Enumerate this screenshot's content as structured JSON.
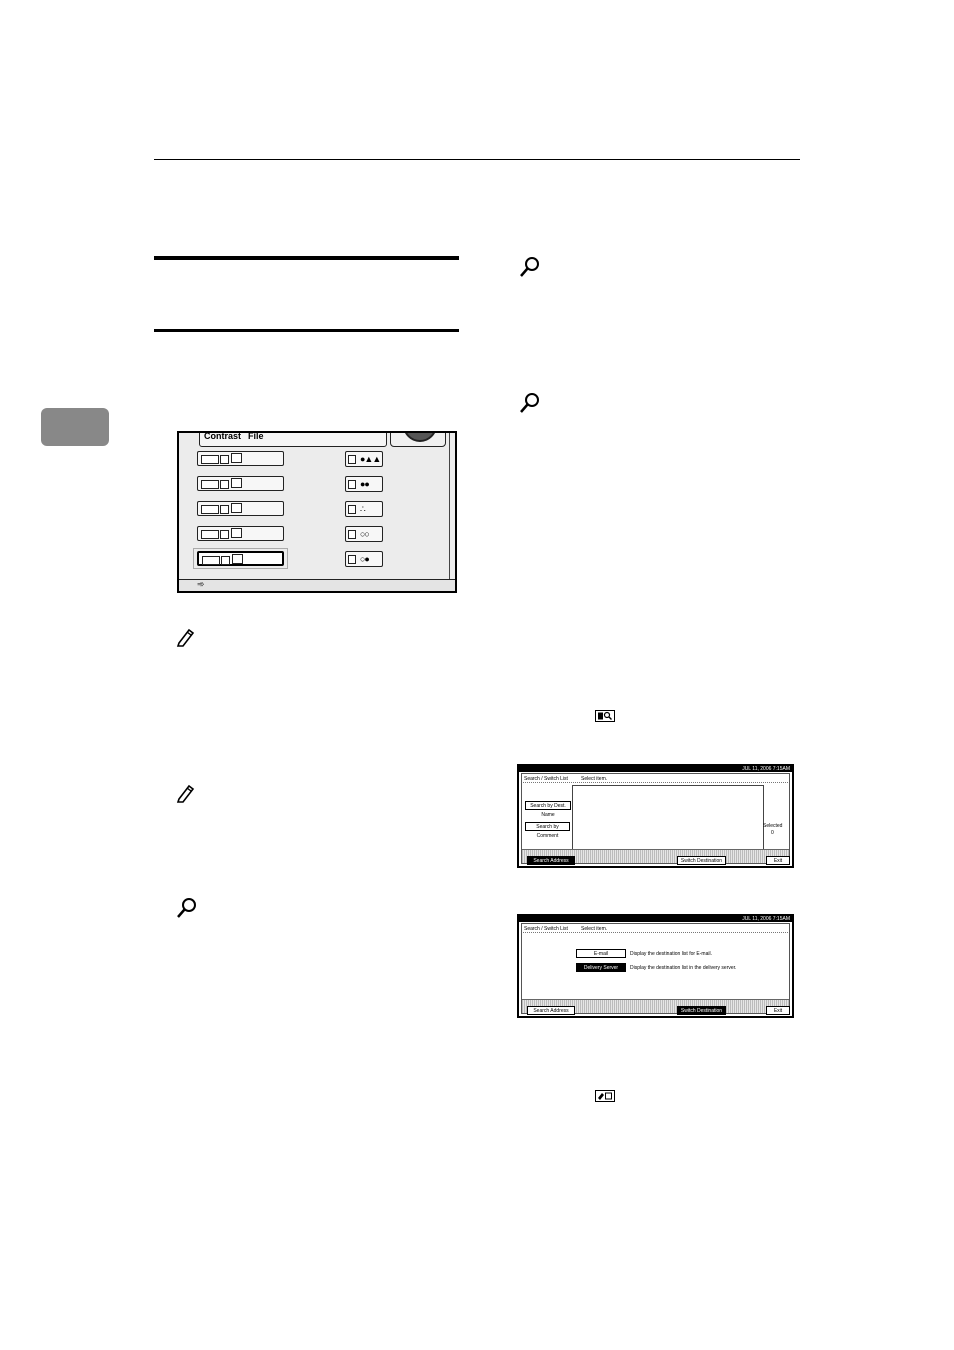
{
  "page": {
    "chapter_tab_label": ""
  },
  "panel": {
    "contrast_label": "Contrast",
    "file_label": "File"
  },
  "screen1": {
    "status_date": "JUL   11, 2006  7:15AM",
    "header_left": "Search / Switch List",
    "header_right": "Select item.",
    "search_by_name_label": "Search by Dest. Name",
    "search_by_comment_label": "Search by Comment",
    "selected_label": "Selected",
    "selected_count": "0",
    "search_address_book_label": "Search Address Book",
    "switch_destination_list_label": "Switch Destination List",
    "exit_label": "Exit"
  },
  "screen2": {
    "status_date": "JUL   11, 2006  7:15AM",
    "header_left": "Search / Switch List",
    "header_right": "Select item.",
    "email_label": "E-mail",
    "email_desc": "Display the destination list for E-mail.",
    "delivery_server_label": "Delivery Server",
    "delivery_server_desc": "Display the destination list in the delivery server.",
    "search_address_book_label": "Search Address Book",
    "switch_destination_list_label": "Switch Destination List",
    "exit_label": "Exit"
  },
  "icons": {
    "reference_icon": "magnifier-icon",
    "note_icon": "pencil-icon",
    "search_dest_key_icon": "search-destination-key-icon",
    "switch_list_key_icon": "switch-list-key-icon"
  }
}
